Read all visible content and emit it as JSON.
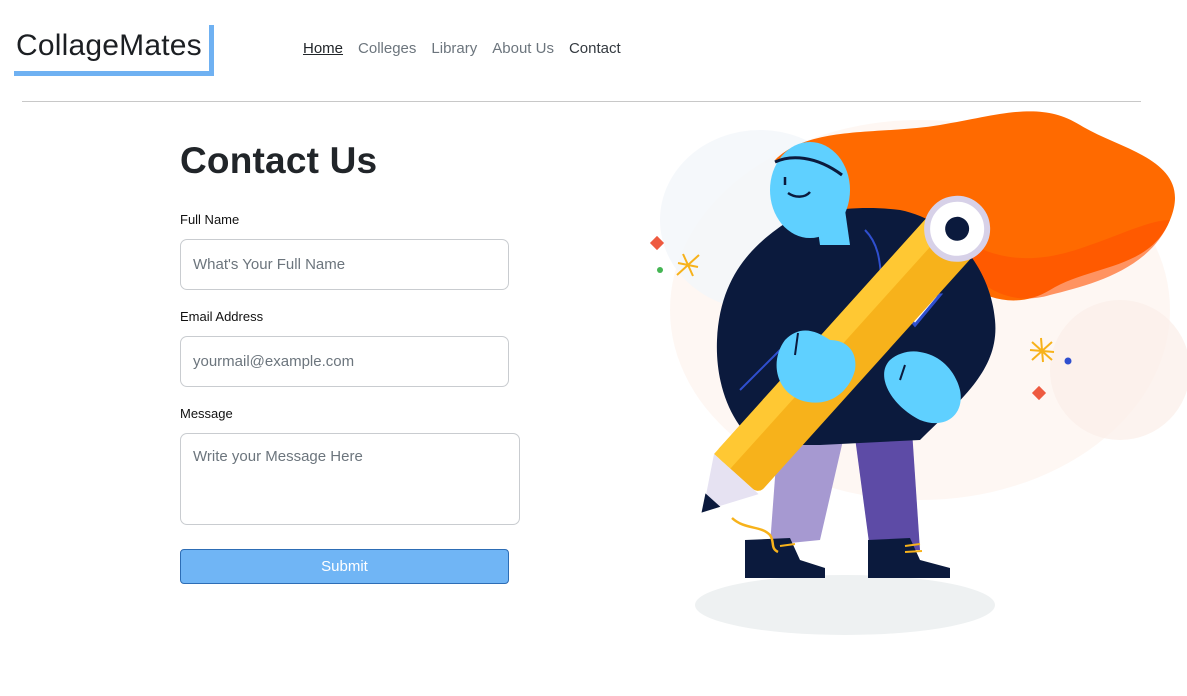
{
  "brand": {
    "name": "CollageMates"
  },
  "nav": {
    "items": [
      {
        "label": "Home"
      },
      {
        "label": "Colleges"
      },
      {
        "label": "Library"
      },
      {
        "label": "About Us"
      },
      {
        "label": "Contact"
      }
    ]
  },
  "form": {
    "title": "Contact Us",
    "full_name_label": "Full Name",
    "full_name_placeholder": "What's Your Full Name",
    "email_label": "Email Address",
    "email_placeholder": "yourmail@example.com",
    "message_label": "Message",
    "message_placeholder": "Write your Message Here",
    "submit_label": "Submit"
  },
  "colors": {
    "accent": "#6fb1f2",
    "submit_bg": "#70b5f5",
    "hair": "#ff6a00",
    "skin": "#5fd0ff",
    "jacket": "#0b1a3d",
    "pencil": "#f7b21b"
  },
  "illustration": {
    "name": "woman-holding-pencil-illustration"
  }
}
